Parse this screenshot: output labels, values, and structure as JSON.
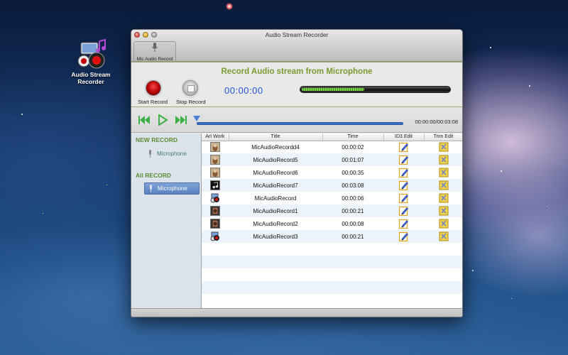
{
  "desktop": {
    "icon_label_line1": "Audio Stream",
    "icon_label_line2": "Recorder"
  },
  "window": {
    "title": "Audio Stream Recorder",
    "toolbar_tab_label": "Mic Audio Record"
  },
  "record": {
    "heading": "Record Audio stream from Microphone",
    "start_label": "Start Record",
    "stop_label": "Stop Record",
    "timer": "00:00:00",
    "level_fraction": 0.42
  },
  "transport": {
    "time_readout": "00:00:00/00:03:08",
    "playhead_fraction": 0.0
  },
  "sidebar": {
    "new_heading": "NEW RECORD",
    "new_item": "Microphone",
    "all_heading": "All RECORD",
    "all_item": "Microphone"
  },
  "table": {
    "columns": [
      "Art Work",
      "Title",
      "Time",
      "ID3 Edit",
      "Trim Edit"
    ],
    "rows": [
      {
        "title": "MicAudioRecordd4",
        "time": "00:00:02",
        "art": "photo-a"
      },
      {
        "title": "MicAudioRecord5",
        "time": "00:01:07",
        "art": "photo-a"
      },
      {
        "title": "MicAudioRecord6",
        "time": "00:00:35",
        "art": "photo-a"
      },
      {
        "title": "MicAudioRecord7",
        "time": "00:03:08",
        "art": "music-note"
      },
      {
        "title": "MicAudioRecord",
        "time": "00:00:06",
        "art": "app-logo"
      },
      {
        "title": "MicAudioRecord1",
        "time": "00:00:21",
        "art": "film-strip"
      },
      {
        "title": "MicAudioRecord2",
        "time": "00:00:08",
        "art": "film-strip"
      },
      {
        "title": "MicAudioRecord3",
        "time": "00:00:21",
        "art": "app-logo"
      }
    ]
  },
  "colors": {
    "heading_green": "#7c9a32",
    "timer_blue": "#2452d6",
    "selection_blue": "#5a82c0"
  }
}
